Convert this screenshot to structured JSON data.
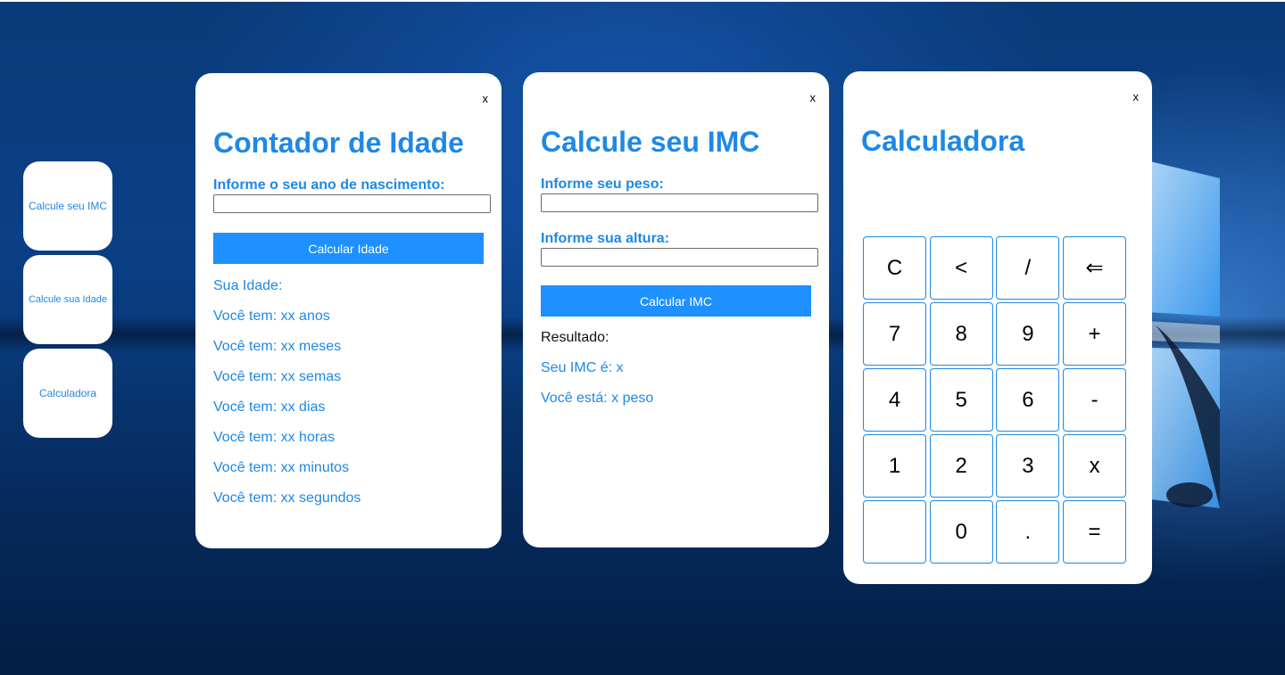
{
  "dock": {
    "imc_label": "Calcule seu IMC",
    "idade_label": "Calcule sua Idade",
    "calc_label": "Calculadora"
  },
  "idade_window": {
    "close": "x",
    "title": "Contador de Idade",
    "field_label": "Informe o seu ano de nascimento:",
    "field_value": "",
    "button": "Calcular Idade",
    "results": [
      "Sua Idade:",
      "Você tem: xx anos",
      "Você tem: xx meses",
      "Você tem: xx semas",
      "Você tem: xx dias",
      "Você tem: xx horas",
      "Você tem: xx minutos",
      "Você tem: xx segundos"
    ]
  },
  "imc_window": {
    "close": "x",
    "title": "Calcule seu IMC",
    "peso_label": "Informe seu peso:",
    "peso_value": "",
    "altura_label": "Informe sua altura:",
    "altura_value": "",
    "button": "Calcular IMC",
    "result_header": "Resultado:",
    "imc_result": "Seu IMC é: x",
    "status_result": "Você está: x peso"
  },
  "calc_window": {
    "close": "x",
    "title": "Calculadora",
    "keys": [
      "C",
      "<",
      "/",
      "⇐",
      "7",
      "8",
      "9",
      "+",
      "4",
      "5",
      "6",
      "-",
      "1",
      "2",
      "3",
      "x",
      "",
      "0",
      ".",
      "="
    ]
  },
  "colors": {
    "accent": "#1e88e5",
    "button_bg": "#1e90ff",
    "desktop_bg": "#0b3f86"
  }
}
